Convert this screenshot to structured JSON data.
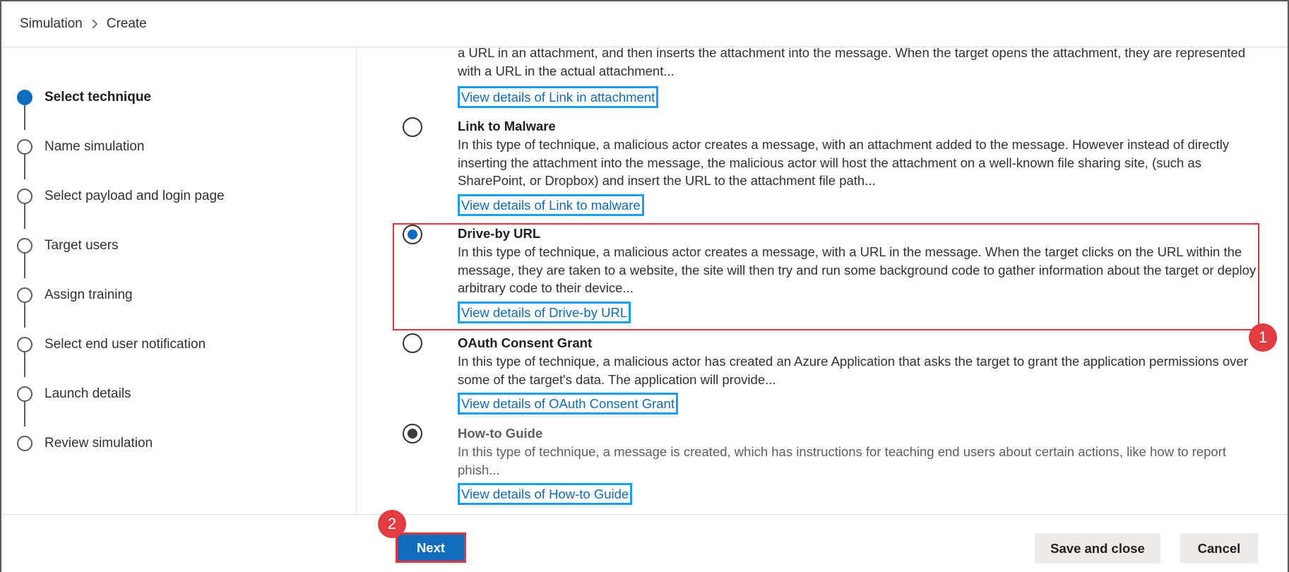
{
  "breadcrumb": {
    "root": "Simulation",
    "separator_icon": "chevron-right-icon",
    "current": "Create"
  },
  "steps": [
    {
      "label": "Select technique",
      "state": "active"
    },
    {
      "label": "Name simulation",
      "state": "pending"
    },
    {
      "label": "Select payload and login page",
      "state": "pending"
    },
    {
      "label": "Target users",
      "state": "pending"
    },
    {
      "label": "Assign training",
      "state": "pending"
    },
    {
      "label": "Select end user notification",
      "state": "pending"
    },
    {
      "label": "Launch details",
      "state": "pending"
    },
    {
      "label": "Review simulation",
      "state": "pending"
    }
  ],
  "techniques": {
    "link_in_attachment": {
      "desc_tail": "a URL in an attachment, and then inserts the attachment into the message. When the target opens the attachment, they are represented with a URL in the actual attachment...",
      "link": "View details of Link in attachment"
    },
    "link_to_malware": {
      "title": "Link to Malware",
      "desc": "In this type of technique, a malicious actor creates a message, with an attachment added to the message. However instead of directly inserting the attachment into the message, the malicious actor will host the attachment on a well-known file sharing site, (such as SharePoint, or Dropbox) and insert the URL to the attachment file path...",
      "link": "View details of Link to malware",
      "selected": false
    },
    "drive_by_url": {
      "title": "Drive-by URL",
      "desc": "In this type of technique, a malicious actor creates a message, with a URL in the message. When the target clicks on the URL within the message, they are taken to a website, the site will then try and run some background code to gather information about the target or deploy arbitrary code to their device...",
      "link": "View details of Drive-by URL",
      "selected": true
    },
    "oauth_consent_grant": {
      "title": "OAuth Consent Grant",
      "desc": "In this type of technique, a malicious actor has created an Azure Application that asks the target to grant the application permissions over some of the target's data. The application will provide...",
      "link": "View details of OAuth Consent Grant",
      "selected": false
    },
    "how_to_guide": {
      "title": "How-to Guide",
      "desc": "In this type of technique, a message is created, which has instructions for teaching end users about certain actions, like how to report phish...",
      "link": "View details of How-to Guide",
      "selected": true,
      "disabled": true
    }
  },
  "annotations": {
    "badge_1": "1",
    "badge_2": "2"
  },
  "footer": {
    "next_label": "Next",
    "save_close_label": "Save and close",
    "cancel_label": "Cancel"
  },
  "colors": {
    "accent": "#0f6cbd",
    "link_highlight": "#1a9ef0",
    "annotation_red": "#e23b41"
  }
}
